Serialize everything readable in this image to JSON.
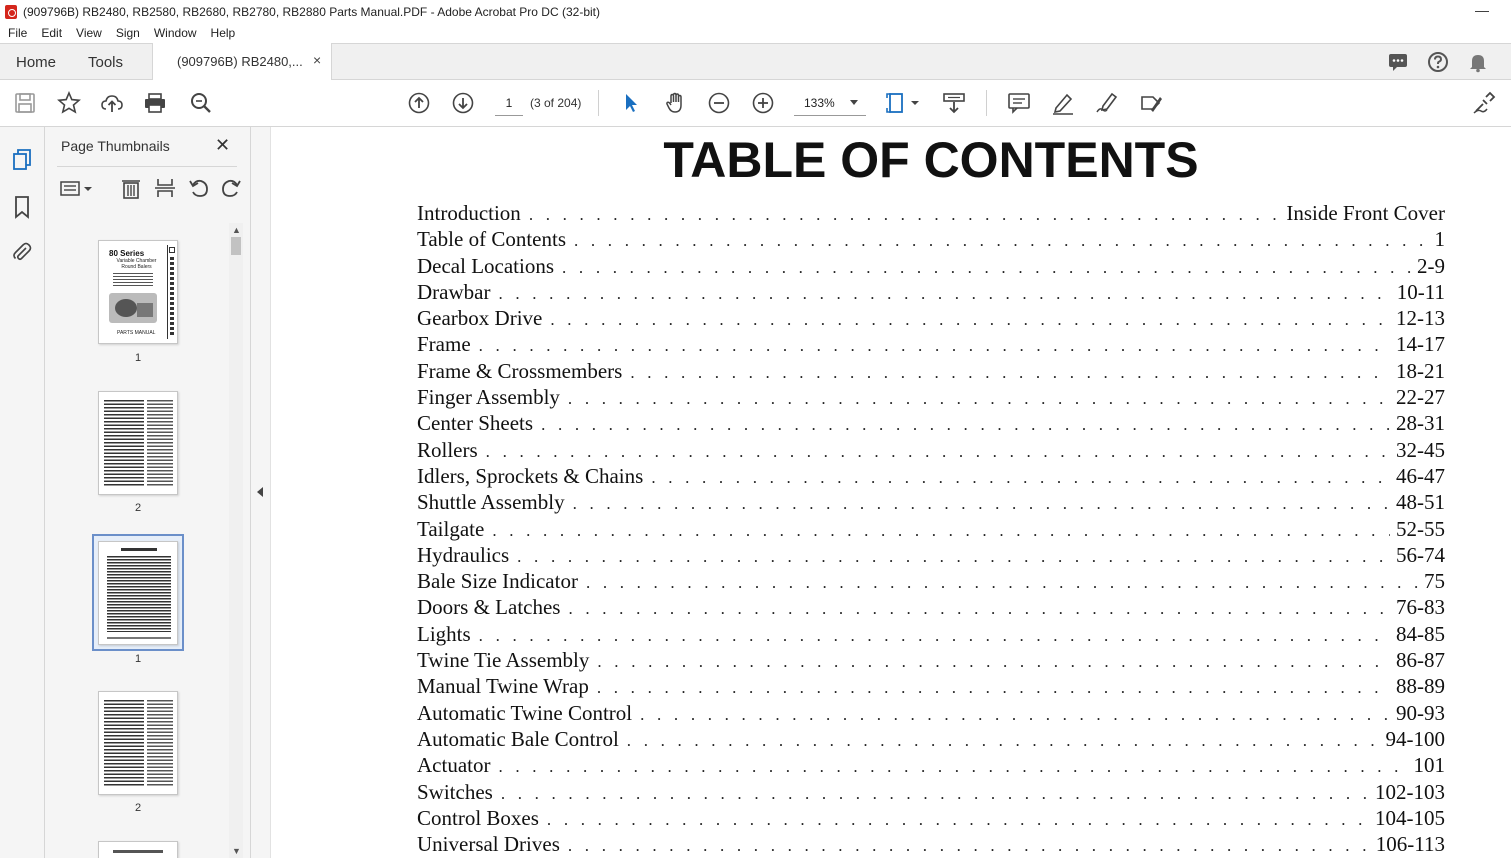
{
  "window": {
    "title": "(909796B) RB2480, RB2580, RB2680, RB2780, RB2880 Parts Manual.PDF - Adobe Acrobat Pro DC (32-bit)",
    "minimize_glyph": "—"
  },
  "menu": [
    "File",
    "Edit",
    "View",
    "Sign",
    "Window",
    "Help"
  ],
  "tabs": {
    "home": "Home",
    "tools": "Tools",
    "document": "(909796B) RB2480,...",
    "close_glyph": "×"
  },
  "toolbar": {
    "page_number": "1",
    "page_of": "(3 of 204)",
    "zoom": "133%"
  },
  "thumbnails": {
    "header": "Page Thumbnails",
    "close_glyph": "✕",
    "items": [
      {
        "label": "1",
        "cover_title": "80 Series",
        "cover_subtitle": "Variable Chamber Round Balers",
        "cover_footer": "PARTS MANUAL"
      },
      {
        "label": "2"
      },
      {
        "label": "1"
      },
      {
        "label": "2"
      }
    ]
  },
  "document": {
    "heading": "TABLE OF CONTENTS",
    "entries": [
      {
        "title": "Introduction",
        "pages": "Inside Front Cover"
      },
      {
        "title": "Table of Contents",
        "pages": "1"
      },
      {
        "title": "Decal Locations",
        "pages": "2-9"
      },
      {
        "title": "Drawbar",
        "pages": "10-11"
      },
      {
        "title": "Gearbox Drive",
        "pages": "12-13"
      },
      {
        "title": "Frame",
        "pages": "14-17"
      },
      {
        "title": "Frame & Crossmembers",
        "pages": "18-21"
      },
      {
        "title": "Finger Assembly",
        "pages": "22-27"
      },
      {
        "title": "Center Sheets",
        "pages": "28-31"
      },
      {
        "title": "Rollers",
        "pages": "32-45"
      },
      {
        "title": "Idlers, Sprockets & Chains",
        "pages": "46-47"
      },
      {
        "title": "Shuttle Assembly",
        "pages": "48-51"
      },
      {
        "title": "Tailgate",
        "pages": "52-55"
      },
      {
        "title": "Hydraulics",
        "pages": "56-74"
      },
      {
        "title": "Bale Size Indicator",
        "pages": "75"
      },
      {
        "title": "Doors & Latches",
        "pages": "76-83"
      },
      {
        "title": "Lights",
        "pages": "84-85"
      },
      {
        "title": "Twine Tie Assembly",
        "pages": "86-87"
      },
      {
        "title": "Manual Twine Wrap",
        "pages": "88-89"
      },
      {
        "title": "Automatic Twine Control",
        "pages": "90-93"
      },
      {
        "title": "Automatic Bale Control",
        "pages": "94-100"
      },
      {
        "title": "Actuator",
        "pages": "101"
      },
      {
        "title": "Switches",
        "pages": "102-103"
      },
      {
        "title": "Control Boxes",
        "pages": "104-105"
      },
      {
        "title": "Universal Drives",
        "pages": "106-113"
      }
    ]
  },
  "colors": {
    "accent_blue": "#1a6fc0",
    "pdf_red": "#d4261c",
    "selection_border": "#6b8fc9"
  }
}
